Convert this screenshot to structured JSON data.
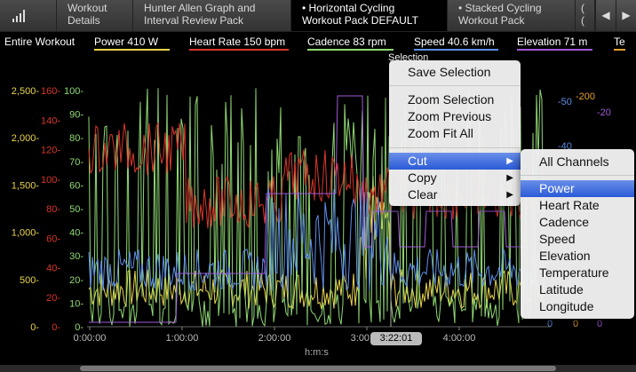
{
  "tabs": [
    {
      "label_line1": "Workout",
      "label_line2": "Details"
    },
    {
      "label_line1": "Hunter Allen Graph and",
      "label_line2": "Interval Review Pack"
    },
    {
      "label_line1": "• Horizontal Cycling",
      "label_line2": "Workout Pack DEFAULT"
    },
    {
      "label_line1": "• Stacked Cycling",
      "label_line2": "Workout Pack"
    },
    {
      "label_line1": "(",
      "label_line2": "("
    }
  ],
  "nav": {
    "prev": "◀",
    "next": "▶"
  },
  "legend": {
    "entire_workout": "Entire Workout",
    "power": "Power  410 W",
    "heart_rate": "Heart Rate  150 bpm",
    "cadence": "Cadence  83 rpm",
    "speed": "Speed  40.6 km/h",
    "elevation": "Elevation  71 m",
    "te": "Te"
  },
  "colors": {
    "power": "#e8d44d",
    "heart_rate": "#d9362b",
    "cadence": "#8fd872",
    "speed": "#5f8fe8",
    "elevation": "#a05ad8",
    "temperature": "#e8a030"
  },
  "axes": {
    "power_ticks": [
      "2,500",
      "2,000",
      "1,500",
      "1,000",
      "500",
      "0"
    ],
    "hr_ticks": [
      "160",
      "140",
      "120",
      "100",
      "80",
      "60",
      "40",
      "20",
      "0"
    ],
    "cadence_ticks": [
      "100",
      "90",
      "80",
      "70",
      "60",
      "50",
      "40",
      "30",
      "20",
      "10",
      "0"
    ],
    "x_ticks": [
      "0:00:00",
      "1:00:00",
      "2:00:00",
      "3:00:00",
      "4:00:00"
    ],
    "x_label": "h:m:s",
    "right_speed_ticks": [
      "-50",
      "-40",
      "0"
    ],
    "right_elev_ticks": [
      "-200",
      "0"
    ],
    "right_temp_ticks": [
      "-20",
      "0"
    ]
  },
  "selection_label": "Selection",
  "time_badge": "3:22:01",
  "context_menu": {
    "save_selection": "Save Selection",
    "zoom_selection": "Zoom Selection",
    "zoom_previous": "Zoom Previous",
    "zoom_fit_all": "Zoom Fit All",
    "cut": "Cut",
    "copy": "Copy",
    "clear": "Clear"
  },
  "submenu": {
    "all_channels": "All Channels",
    "items": [
      "Power",
      "Heart Rate",
      "Cadence",
      "Speed",
      "Elevation",
      "Temperature",
      "Latitude",
      "Longitude"
    ]
  }
}
